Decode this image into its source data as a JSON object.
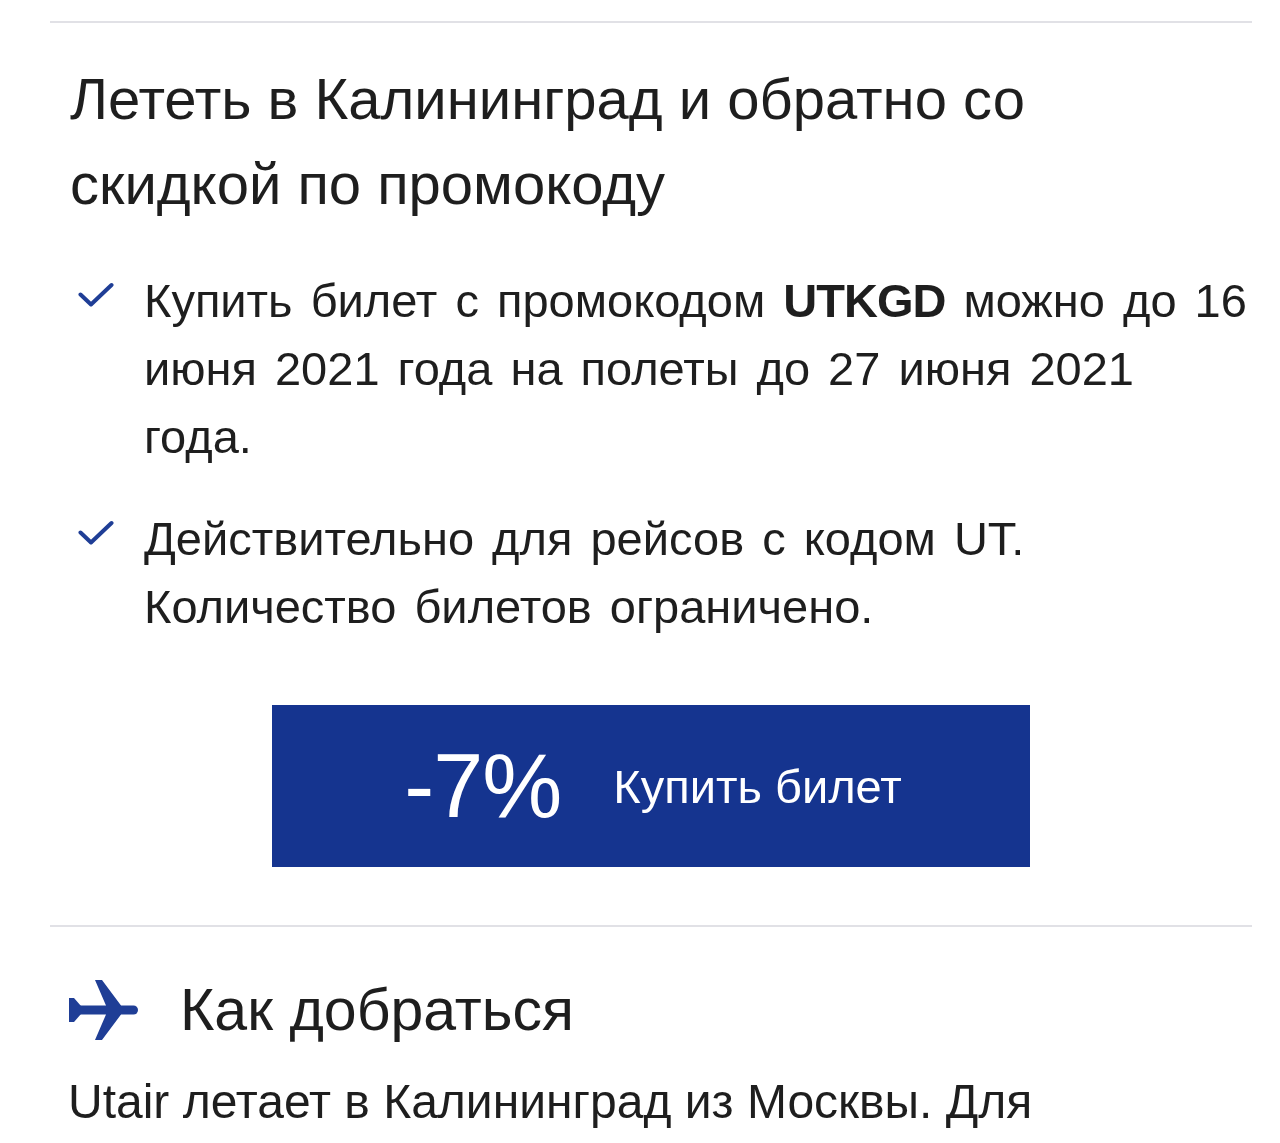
{
  "promo": {
    "title": "Лететь в Калининград и обратно со скидкой по промокоду",
    "conditions": [
      {
        "text": "Купить билет с промокодом **UTKGD** можно до 16 июня 2021 года на полеты до 27 июня 2021 года."
      },
      {
        "text": "Действительно для рейсов с кодом UT. Количество билетов ограничено."
      }
    ],
    "buy_button": {
      "discount": "-7%",
      "label": "Купить билет"
    }
  },
  "how_to_get": {
    "heading": "Как добраться",
    "text": "Utair летает в Калининград из Москвы. Для"
  }
}
